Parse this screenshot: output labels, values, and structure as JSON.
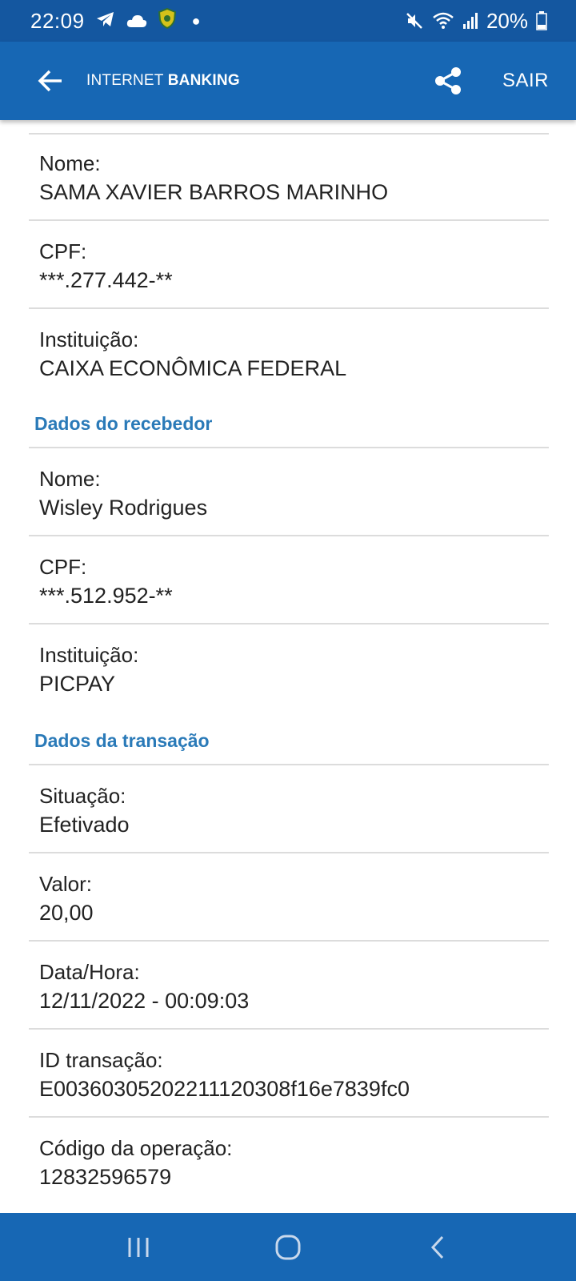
{
  "status_bar": {
    "time": "22:09",
    "battery": "20%",
    "icons": [
      "telegram-icon",
      "cloud-icon",
      "shield-badge-icon",
      "mute-icon",
      "wifi-icon",
      "signal-icon",
      "battery-icon"
    ]
  },
  "app_bar": {
    "title_light": "INTERNET ",
    "title_bold": "BANKING",
    "exit_label": "SAIR",
    "color": "#1767b4"
  },
  "payer": {
    "name_label": "Nome:",
    "name_value": "SAMA XAVIER BARROS MARINHO",
    "cpf_label": "CPF:",
    "cpf_value": "***.277.442-**",
    "institution_label": "Instituição:",
    "institution_value": "CAIXA ECONÔMICA FEDERAL"
  },
  "receiver": {
    "heading": "Dados do recebedor",
    "name_label": "Nome:",
    "name_value": "Wisley Rodrigues",
    "cpf_label": "CPF:",
    "cpf_value": "***.512.952-**",
    "institution_label": "Instituição:",
    "institution_value": "PICPAY"
  },
  "transaction": {
    "heading": "Dados da transação",
    "status_label": "Situação:",
    "status_value": "Efetivado",
    "amount_label": "Valor:",
    "amount_value": "20,00",
    "datetime_label": "Data/Hora:",
    "datetime_value": "12/11/2022 - 00:09:03",
    "id_label": "ID transação:",
    "id_value": "E00360305202211120308f16e7839fc0",
    "operation_label": "Código da operação:",
    "operation_value": "12832596579"
  },
  "colors": {
    "status_bar": "#1457a0",
    "heading": "#2a7ab8",
    "separator": "#dcdcdc"
  }
}
